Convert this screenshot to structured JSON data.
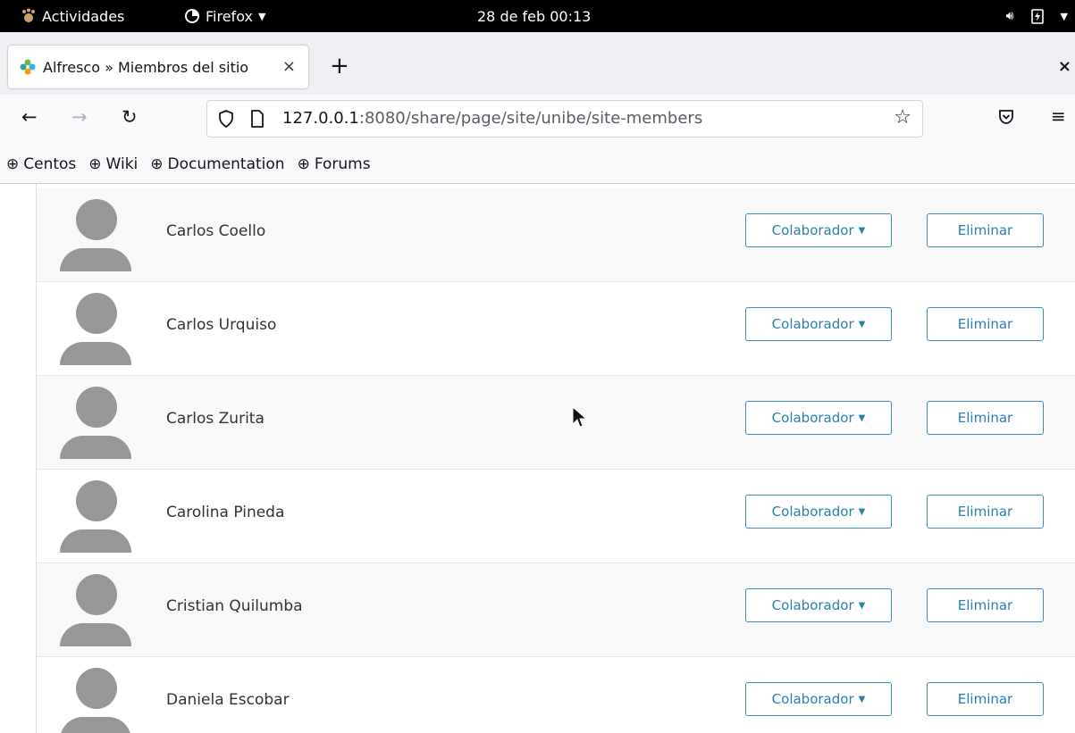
{
  "topbar": {
    "activities": "Actividades",
    "app_name": "Firefox",
    "clock": "28 de feb  00:13"
  },
  "browser": {
    "tab_title": "Alfresco » Miembros del sitio",
    "new_tab": "+",
    "close_tab": "×",
    "window_close": "×",
    "url_host": "127.0.0.1",
    "url_rest": ":8080/share/page/site/unibe/site-members",
    "bookmarks": [
      {
        "label": "Centos"
      },
      {
        "label": "Wiki"
      },
      {
        "label": "Documentation"
      },
      {
        "label": "Forums"
      }
    ]
  },
  "members": [
    {
      "name": "Carlos Coello",
      "role": "Colaborador",
      "remove": "Eliminar"
    },
    {
      "name": "Carlos Urquiso",
      "role": "Colaborador",
      "remove": "Eliminar"
    },
    {
      "name": "Carlos Zurita",
      "role": "Colaborador",
      "remove": "Eliminar"
    },
    {
      "name": "Carolina Pineda",
      "role": "Colaborador",
      "remove": "Eliminar"
    },
    {
      "name": "Cristian Quilumba",
      "role": "Colaborador",
      "remove": "Eliminar"
    },
    {
      "name": "Daniela Escobar",
      "role": "Colaborador",
      "remove": "Eliminar"
    }
  ],
  "colors": {
    "accent": "#2a7fb0",
    "avatar": "#979797"
  }
}
